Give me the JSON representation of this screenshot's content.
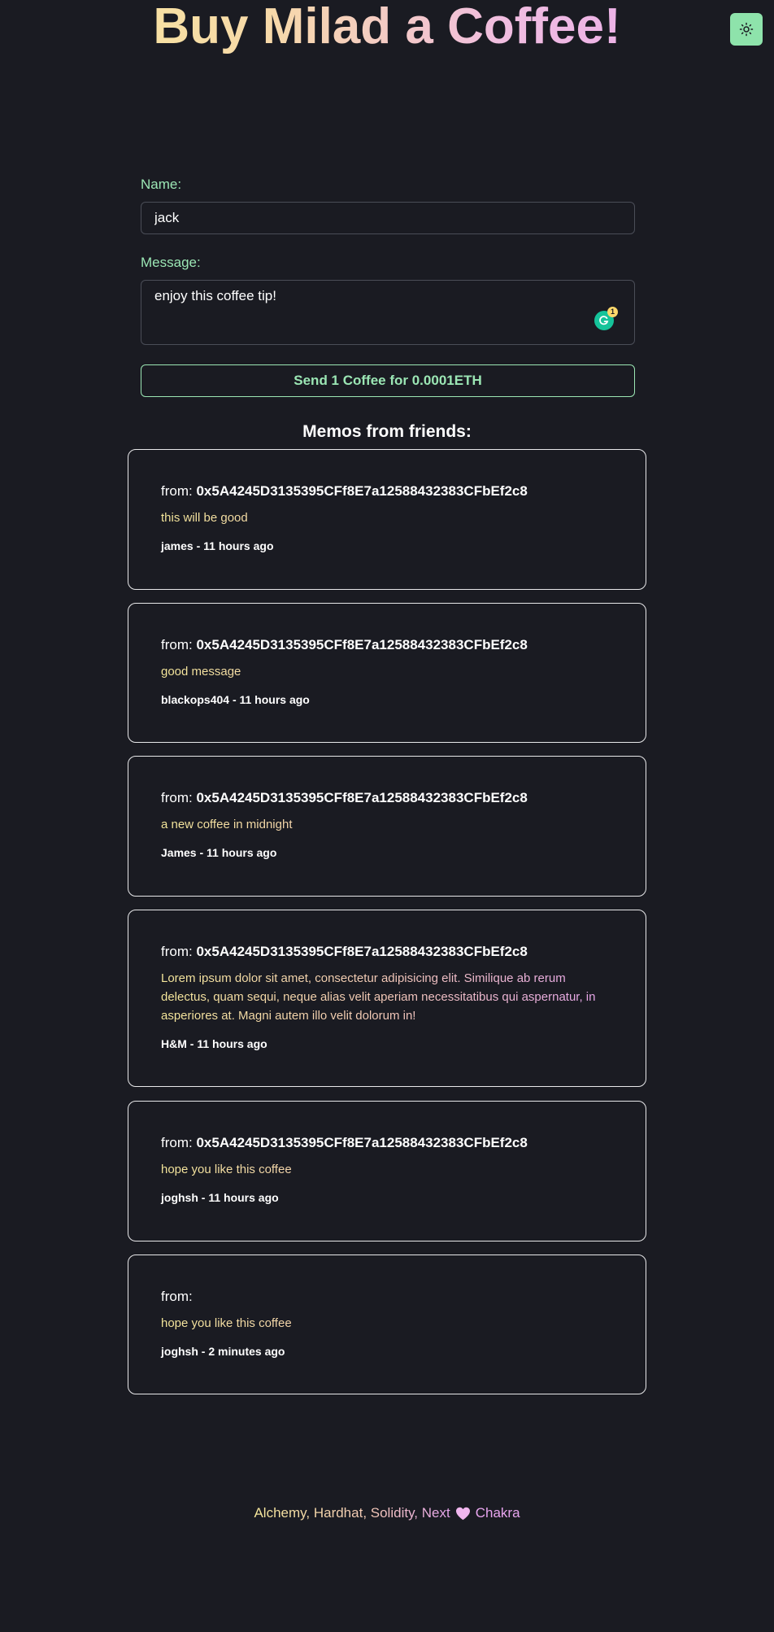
{
  "header": {
    "title": "Buy Milad a Coffee!",
    "theme_toggle_icon": "sun-icon"
  },
  "form": {
    "name_label": "Name:",
    "name_value": "jack",
    "message_label": "Message:",
    "message_value": "enjoy this coffee tip!",
    "grammarly_badge": "1",
    "send_button_label": "Send 1 Coffee for 0.0001ETH"
  },
  "memos": {
    "heading": "Memos from friends:",
    "from_prefix": "from:",
    "items": [
      {
        "address": "0x5A4245D3135395CFf8E7a12588432383CFbEf2c8",
        "message": "this will be good",
        "meta": "james - 11 hours ago"
      },
      {
        "address": "0x5A4245D3135395CFf8E7a12588432383CFbEf2c8",
        "message": "good message",
        "meta": "blackops404 - 11 hours ago"
      },
      {
        "address": "0x5A4245D3135395CFf8E7a12588432383CFbEf2c8",
        "message": "a new coffee in midnight",
        "meta": "James - 11 hours ago"
      },
      {
        "address": "0x5A4245D3135395CFf8E7a12588432383CFbEf2c8",
        "message": "Lorem ipsum dolor sit amet, consectetur adipisicing elit. Similique ab rerum delectus, quam sequi, neque alias velit aperiam necessitatibus qui aspernatur, in asperiores at. Magni autem illo velit dolorum in!",
        "meta": "H&M - 11 hours ago"
      },
      {
        "address": "0x5A4245D3135395CFf8E7a12588432383CFbEf2c8",
        "message": "hope you like this coffee",
        "meta": "joghsh - 11 hours ago"
      },
      {
        "address": "",
        "message": "hope you like this coffee",
        "meta": "joghsh - 2 minutes ago"
      }
    ]
  },
  "footer": {
    "text": "Alchemy, Hardhat, Solidity, Next",
    "heart_icon": "heart-icon",
    "chakra": "Chakra"
  },
  "colors": {
    "background": "#1a1b22",
    "accent_green": "#9be6b4",
    "toggle_bg": "#8ee3ab",
    "gradient_yellow": "#f8ea9c",
    "gradient_pink": "#e8a5ef"
  }
}
